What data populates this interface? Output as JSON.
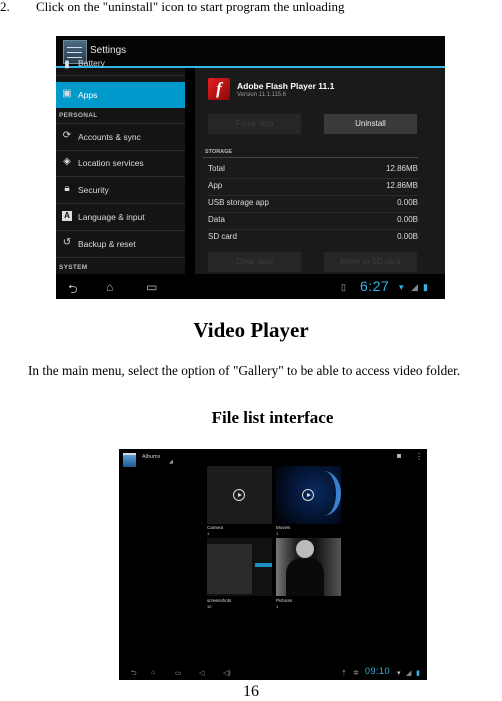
{
  "document": {
    "step": {
      "number": "2.",
      "text": "Click on the \"uninstall\" icon to start program the unloading"
    },
    "heading": "Video Player",
    "paragraph": "In the main menu, select the option of \"Gallery\" to be able to access video folder.",
    "subheading": "File list interface",
    "page_number": "16"
  },
  "settings_screenshot": {
    "title": "Settings",
    "sidebar": {
      "items": [
        {
          "label": "Battery",
          "icon": "battery-icon"
        },
        {
          "label": "Apps",
          "icon": "apps-icon",
          "active": true
        },
        {
          "label": "Accounts & sync",
          "icon": "sync-icon"
        },
        {
          "label": "Location services",
          "icon": "location-icon"
        },
        {
          "label": "Security",
          "icon": "lock-icon"
        },
        {
          "label": "Language & input",
          "icon": "language-icon"
        },
        {
          "label": "Backup & reset",
          "icon": "backup-icon"
        }
      ],
      "sections": [
        "PERSONAL",
        "SYSTEM"
      ]
    },
    "app_info": {
      "name": "Adobe Flash Player 11.1",
      "version": "Version 11.1.115.6",
      "buttons": {
        "force_stop": "Force stop",
        "uninstall": "Uninstall",
        "clear_data": "Clear data",
        "move_to_sd": "Move to SD card"
      },
      "storage_header": "STORAGE",
      "storage": [
        {
          "label": "Total",
          "value": "12.86MB"
        },
        {
          "label": "App",
          "value": "12.86MB"
        },
        {
          "label": "USB storage app",
          "value": "0.00B"
        },
        {
          "label": "Data",
          "value": "0.00B"
        },
        {
          "label": "SD card",
          "value": "0.00B"
        }
      ]
    },
    "status_bar": {
      "time": "6:27"
    },
    "accent_color": "#33b5e5",
    "active_item_color": "#0099cc"
  },
  "gallery_screenshot": {
    "title": "Albums",
    "albums": [
      {
        "name": "Camera",
        "count": "1"
      },
      {
        "name": "Movies",
        "count": "1"
      },
      {
        "name": "screenshots",
        "count": "10"
      },
      {
        "name": "Pictures",
        "count": "1"
      }
    ],
    "status_bar": {
      "time": "09:10"
    }
  }
}
